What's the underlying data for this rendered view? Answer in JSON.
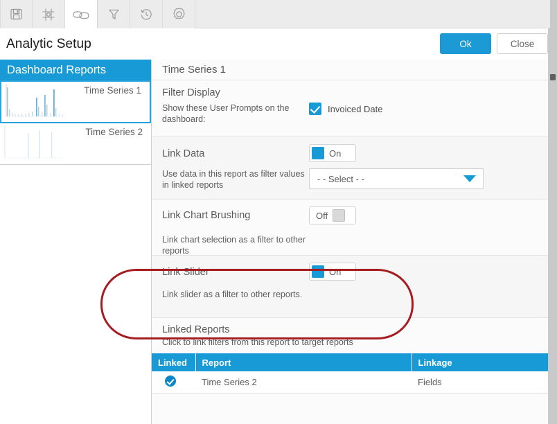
{
  "toolbar": {
    "items": [
      {
        "name": "save-icon",
        "label": "Save",
        "active": false
      },
      {
        "name": "layout-icon",
        "label": "Layout",
        "active": false
      },
      {
        "name": "link-icon",
        "label": "Link",
        "active": true
      },
      {
        "name": "filter-icon",
        "label": "Filter",
        "active": false
      },
      {
        "name": "history-icon",
        "label": "History",
        "active": false
      },
      {
        "name": "gear-icon",
        "label": "Settings",
        "active": false
      }
    ]
  },
  "header": {
    "title": "Analytic Setup",
    "ok_label": "Ok",
    "close_label": "Close"
  },
  "sidebar": {
    "header": "Dashboard Reports",
    "items": [
      {
        "label": "Time Series 1",
        "selected": true
      },
      {
        "label": "Time Series 2",
        "selected": false
      }
    ]
  },
  "main": {
    "title": "Time Series 1",
    "filter_display": {
      "title": "Filter Display",
      "description": "Show these User Prompts on the dashboard:",
      "prompts": [
        {
          "label": "Invoiced Date",
          "checked": true
        }
      ]
    },
    "link_data": {
      "title": "Link Data",
      "description": "Use data in this report as filter values in linked reports",
      "toggle_state": "On",
      "select_value": "- - Select - -"
    },
    "link_chart_brushing": {
      "title": "Link Chart Brushing",
      "description": "Link chart selection as a filter to other reports",
      "toggle_state": "Off"
    },
    "link_slider": {
      "title": "Link Slider",
      "description": "Link slider as a filter to other reports.",
      "toggle_state": "On"
    },
    "linked_reports": {
      "title": "Linked Reports",
      "subtitle": "Click to link filters from this report to target reports",
      "columns": [
        "Linked",
        "Report",
        "Linkage"
      ],
      "rows": [
        {
          "linked": true,
          "report": "Time Series 2",
          "linkage": "Fields"
        }
      ]
    }
  },
  "colors": {
    "accent": "#189ad6",
    "annotation": "#a51c21",
    "toolbar_bg": "#ececec",
    "panel_bg": "#fbfbfb"
  }
}
